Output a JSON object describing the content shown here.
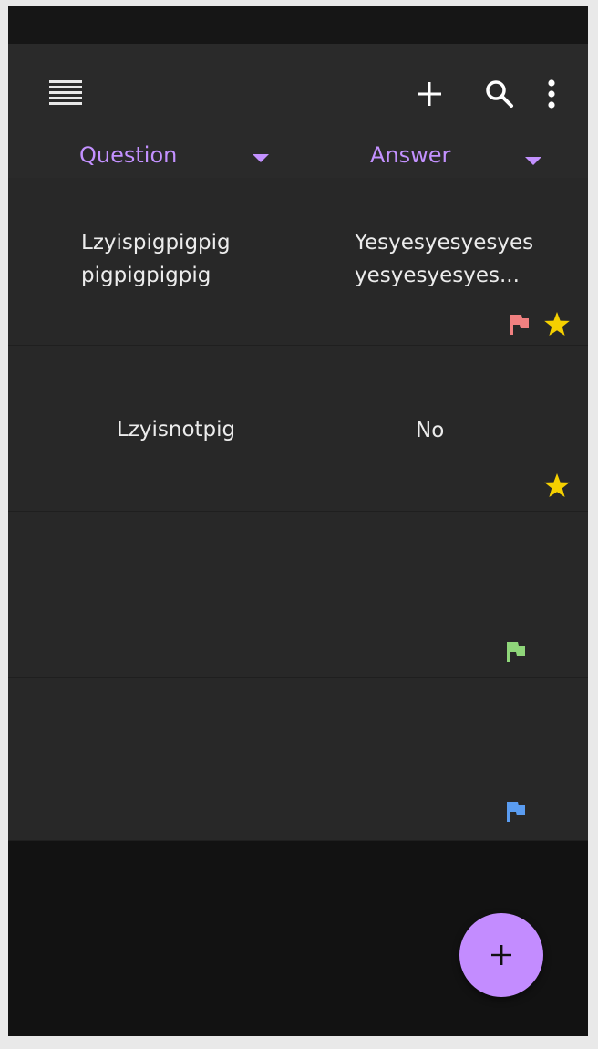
{
  "toolbar": {
    "menu_icon": "list-icon",
    "add_icon": "plus-icon",
    "search_icon": "search-icon",
    "more_icon": "more-vert-icon"
  },
  "columns": [
    {
      "label": "Question"
    },
    {
      "label": "Answer"
    }
  ],
  "rows": [
    {
      "question": "Lzyispigpigpig\npigpigpigpig",
      "answer": "Yesyesyesyesyes\nyesyesyesyes...",
      "flag": "red",
      "starred": true
    },
    {
      "question": "Lzyisnotpig",
      "answer": "No",
      "flag": null,
      "starred": true
    },
    {
      "question": "",
      "answer": "",
      "flag": "green",
      "starred": false
    },
    {
      "question": "",
      "answer": "",
      "flag": "blue",
      "starred": false
    }
  ],
  "colors": {
    "accent": "#c391ff",
    "flag_red": "#f08080",
    "flag_green": "#8fd67a",
    "flag_blue": "#5a9cf0",
    "star": "#f5d000",
    "fab": "#c38cff"
  },
  "fab": {
    "icon": "plus-icon"
  }
}
